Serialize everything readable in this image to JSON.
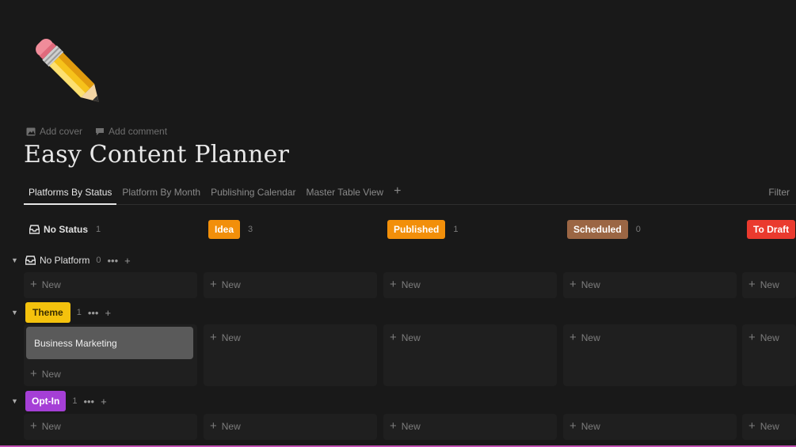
{
  "page": {
    "icon": "pencil-icon",
    "add_cover": "Add cover",
    "add_comment": "Add comment",
    "title": "Easy Content Planner"
  },
  "tabs": [
    {
      "label": "Platforms By Status",
      "active": true
    },
    {
      "label": "Platform By Month",
      "active": false
    },
    {
      "label": "Publishing Calendar",
      "active": false
    },
    {
      "label": "Master Table View",
      "active": false
    }
  ],
  "filter_label": "Filter",
  "columns": [
    {
      "label": "No Status",
      "count": "1",
      "color": null
    },
    {
      "label": "Idea",
      "count": "3",
      "color": "#f28f0a"
    },
    {
      "label": "Published",
      "count": "1",
      "color": "#f28f0a"
    },
    {
      "label": "Scheduled",
      "count": "0",
      "color": "#9b6644"
    },
    {
      "label": "To Draft",
      "count": "",
      "color": "#ea3a2e"
    }
  ],
  "groups": [
    {
      "label": "No Platform",
      "count": "0",
      "color": null
    },
    {
      "label": "Theme",
      "count": "1",
      "color": "#f4c20d"
    },
    {
      "label": "Opt-In",
      "count": "1",
      "color": "#a53fd6"
    }
  ],
  "card": {
    "title": "Business Marketing"
  },
  "new_label": "New"
}
